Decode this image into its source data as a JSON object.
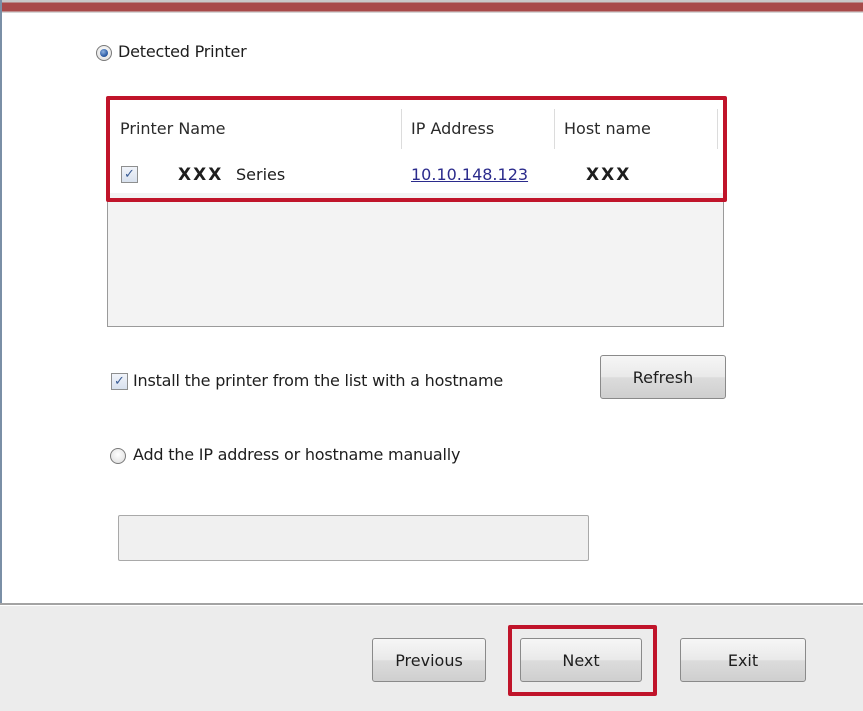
{
  "detected_printer": {
    "label": "Detected Printer",
    "selected": true
  },
  "printer_list": {
    "columns": [
      "Printer Name",
      "IP Address",
      "Host name"
    ],
    "rows": [
      {
        "checked": true,
        "name_bold": "XXX",
        "name_suffix": "Series",
        "ip_address": "10.10.148.123",
        "host_name": "XXX"
      }
    ]
  },
  "install_with_hostname": {
    "label": "Install the printer from the list with a hostname",
    "checked": true
  },
  "refresh_button": {
    "label": "Refresh"
  },
  "manual_entry": {
    "label": "Add the IP address or hostname manually",
    "selected": false,
    "value": ""
  },
  "footer": {
    "previous_label": "Previous",
    "next_label": "Next",
    "exit_label": "Exit"
  },
  "colors": {
    "highlight": "#c0142a",
    "link": "#2b2b8c",
    "title_band": "#a84a4a"
  },
  "icons": {
    "checkbox_checked": "checkmark-icon",
    "radio_selected": "radio-dot-icon"
  }
}
